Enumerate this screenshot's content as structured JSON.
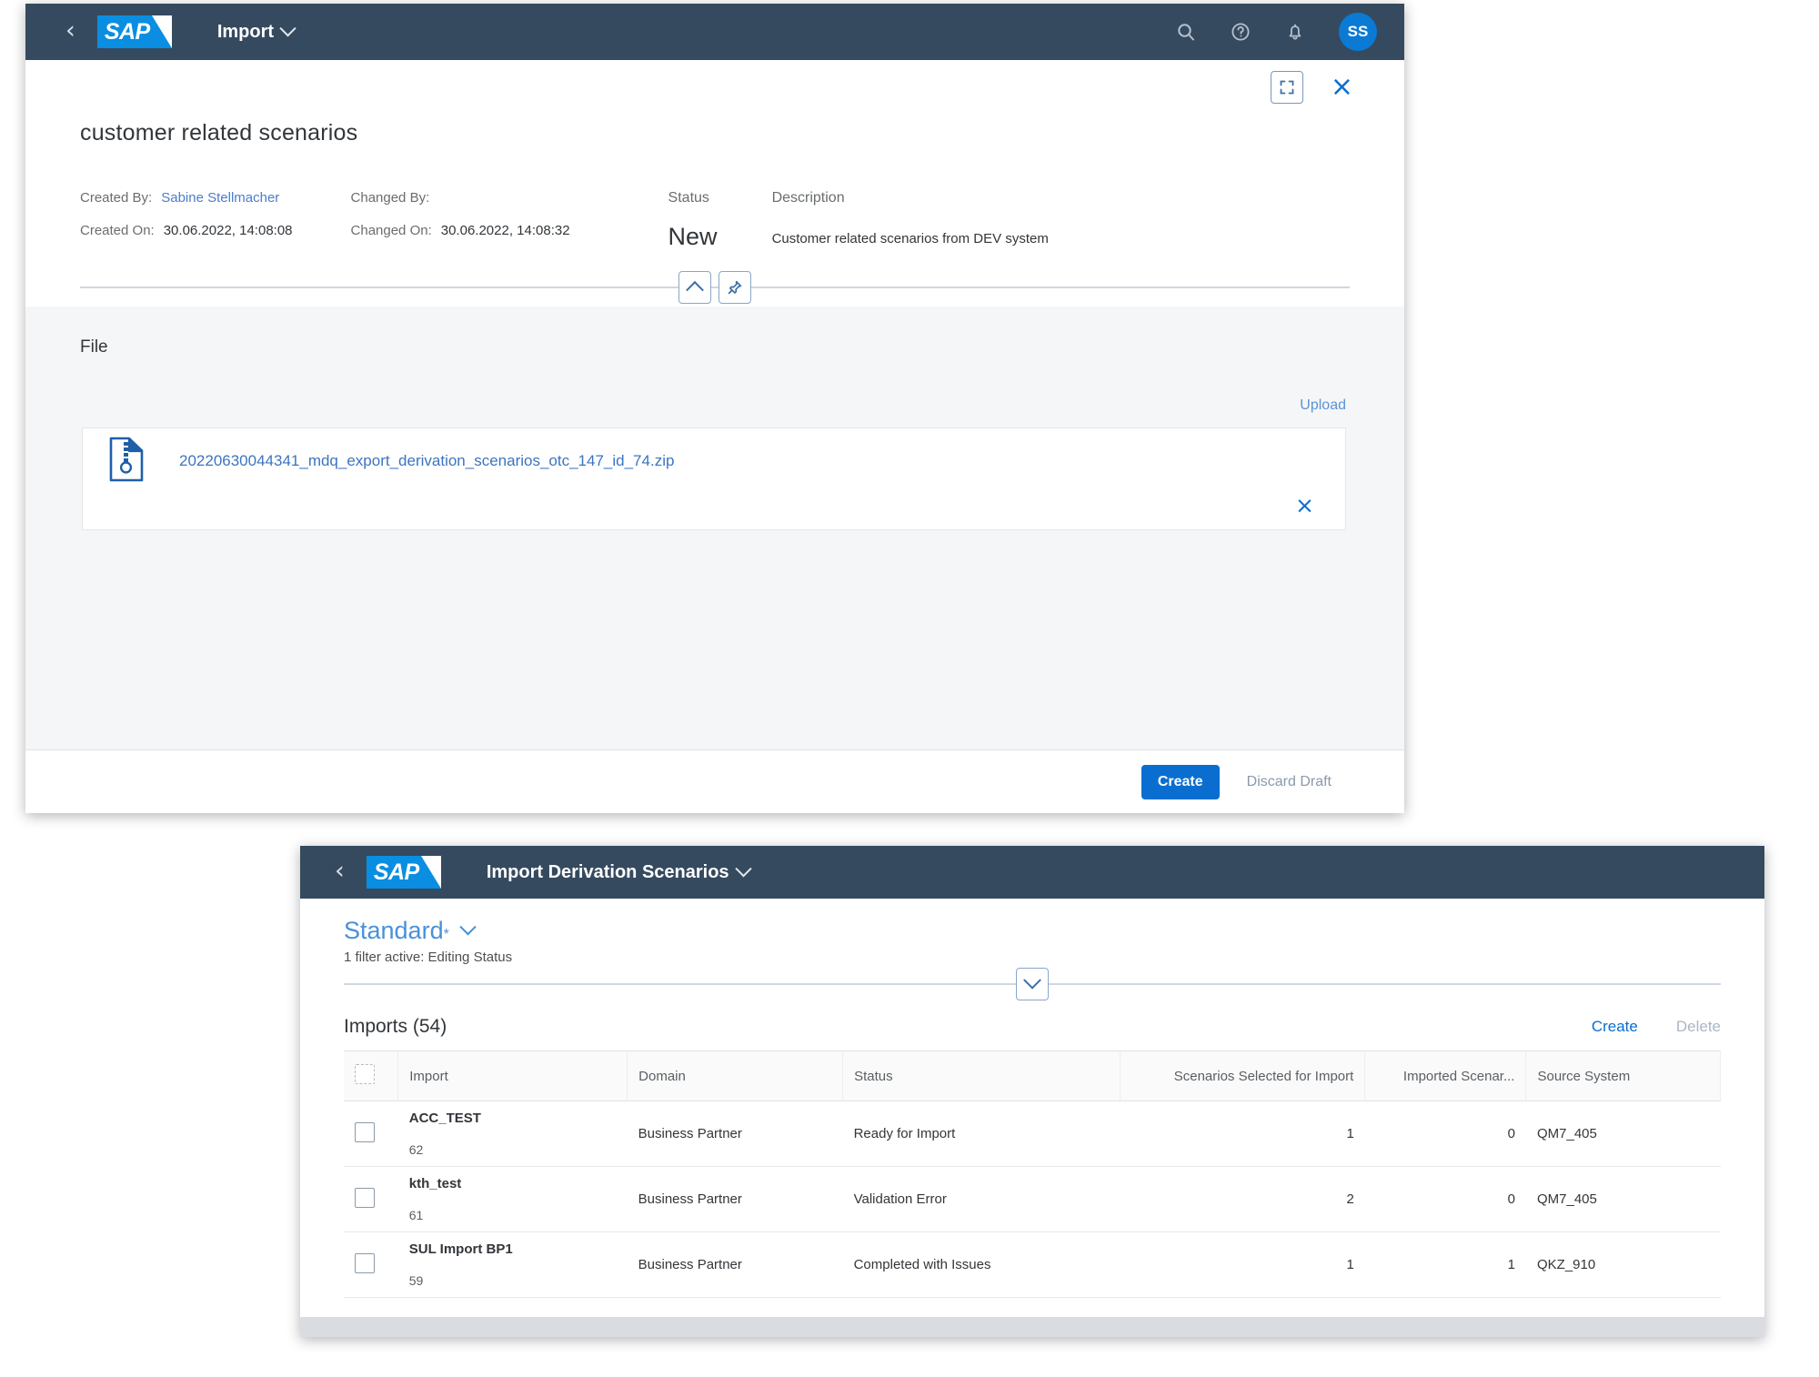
{
  "window_import": {
    "shell": {
      "back_icon": "back-chevron-icon",
      "logo_text": "SAP",
      "title": "Import",
      "icons": [
        "search-icon",
        "help-icon",
        "notifications-icon"
      ],
      "avatar_initials": "SS"
    },
    "dialog_tools": {
      "fullscreen_label": "fullscreen-icon",
      "close_label": "×"
    },
    "object_title": "customer related scenarios",
    "fields": {
      "created_by_label": "Created By:",
      "created_by_value": "Sabine Stellmacher",
      "created_on_label": "Created On:",
      "created_on_value": "30.06.2022, 14:08:08",
      "changed_by_label": "Changed By:",
      "changed_by_value": "",
      "changed_on_label": "Changed On:",
      "changed_on_value": "30.06.2022, 14:08:32",
      "status_label": "Status",
      "status_value": "New",
      "description_label": "Description",
      "description_value": "Customer related scenarios from DEV system"
    },
    "file_section": {
      "heading": "File",
      "upload_label": "Upload",
      "file_name": "20220630044341_mdq_export_derivation_scenarios_otc_147_id_74.zip",
      "remove_label": "×"
    },
    "footer": {
      "create_label": "Create",
      "discard_label": "Discard Draft"
    }
  },
  "window_list": {
    "shell": {
      "back_icon": "back-chevron-icon",
      "logo_text": "SAP",
      "title": "Import Derivation Scenarios"
    },
    "filter_bar": {
      "variant": "Standard",
      "variant_dirty_marker": "*",
      "filter_summary": "1 filter active: Editing Status"
    },
    "table": {
      "title": "Imports (54)",
      "create_label": "Create",
      "delete_label": "Delete",
      "columns": [
        "Import",
        "Domain",
        "Status",
        "Scenarios Selected for Import",
        "Imported Scenar...",
        "Source System"
      ],
      "rows": [
        {
          "import_name": "ACC_TEST",
          "import_id": "62",
          "domain": "Business Partner",
          "status": "Ready for Import",
          "status_color": "#2b7d2b",
          "scenarios_selected": "1",
          "imported_scenarios": "0",
          "source_system": "QM7_405"
        },
        {
          "import_name": "kth_test",
          "import_id": "61",
          "domain": "Business Partner",
          "status": "Validation Error",
          "status_color": "#d93b3b",
          "scenarios_selected": "2",
          "imported_scenarios": "0",
          "source_system": "QM7_405"
        },
        {
          "import_name": "SUL Import BP1",
          "import_id": "59",
          "domain": "Business Partner",
          "status": "Completed with Issues",
          "status_color": "#e07a2f",
          "scenarios_selected": "1",
          "imported_scenarios": "1",
          "source_system": "QKZ_910"
        }
      ]
    }
  },
  "colors": {
    "shell_bar": "#354a5f",
    "brand_blue": "#0a6ed1",
    "logo_blue": "#0a8ee1",
    "link_blue": "#4a7ecb"
  }
}
